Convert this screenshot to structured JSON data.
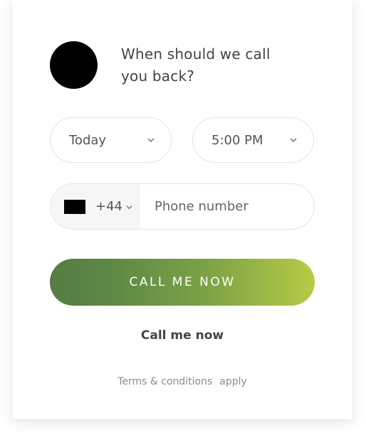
{
  "heading": "When should we call you back?",
  "day_select": {
    "value": "Today",
    "icon": "chevron-down-icon"
  },
  "time_select": {
    "value": "5:00 PM",
    "icon": "chevron-down-icon"
  },
  "phone": {
    "country_code": "+44",
    "flag_icon": "flag-icon",
    "placeholder": "Phone number",
    "value": ""
  },
  "cta_label": "CALL ME NOW",
  "secondary_label": "Call me now",
  "terms": {
    "link": "Terms & conditions",
    "suffix": "apply"
  },
  "colors": {
    "gradient_start": "#557c45",
    "gradient_end": "#b6cc46",
    "text": "#444444",
    "muted": "#8a8a8a"
  }
}
